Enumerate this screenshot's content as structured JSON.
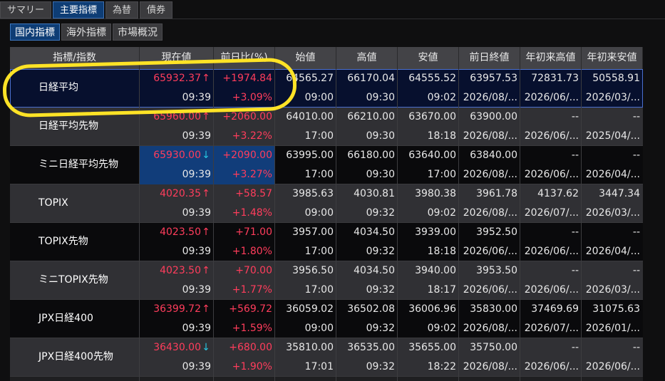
{
  "top_tabs": [
    "サマリー",
    "主要指標",
    "為替",
    "債券"
  ],
  "top_active": 1,
  "sub_tabs": [
    "国内指標",
    "海外指標",
    "市場概況"
  ],
  "sub_active": 0,
  "columns": [
    "指標/指数",
    "現在値",
    "前日比(%)",
    "始値",
    "高値",
    "安値",
    "前日終値",
    "年初来高値",
    "年初来安値"
  ],
  "colors": {
    "up": "#ff3d5c",
    "down": "#27c4e0",
    "annotation": "#ffe326",
    "selected_row": "#07102e"
  },
  "rows": [
    {
      "name": "日経平均",
      "price": "65932.37",
      "dir": "up",
      "chg": "+1974.84",
      "time": "09:39",
      "pct": "+3.09%",
      "open": "64565.27",
      "open_t": "09:00",
      "high": "66170.04",
      "high_t": "09:30",
      "low": "64555.52",
      "low_t": "09:02",
      "prev": "63957.53",
      "prev_d": "2026/08/...",
      "yh": "72831.73",
      "yh_d": "2026/06/...",
      "yl": "50558.91",
      "yl_d": "2026/03/...",
      "selected": true,
      "highlight": false
    },
    {
      "name": "日経平均先物",
      "price": "65960.00",
      "dir": "up",
      "chg": "+2060.00",
      "time": "09:39",
      "pct": "+3.22%",
      "open": "64010.00",
      "open_t": "17:00",
      "high": "66210.00",
      "high_t": "09:30",
      "low": "63670.00",
      "low_t": "18:18",
      "prev": "63900.00",
      "prev_d": "2026/08/...",
      "yh": "--",
      "yh_d": "2026/06/...",
      "yl": "--",
      "yl_d": "2025/04/...",
      "selected": false,
      "highlight": false
    },
    {
      "name": "ミニ日経平均先物",
      "price": "65930.00",
      "dir": "down",
      "chg": "+2090.00",
      "time": "09:39",
      "pct": "+3.27%",
      "open": "63995.00",
      "open_t": "17:00",
      "high": "66180.00",
      "high_t": "09:30",
      "low": "63640.00",
      "low_t": "17:00",
      "prev": "63840.00",
      "prev_d": "2026/08/...",
      "yh": "--",
      "yh_d": "2026/06/...",
      "yl": "--",
      "yl_d": "2026/04/...",
      "selected": false,
      "highlight": true
    },
    {
      "name": "TOPIX",
      "price": "4020.35",
      "dir": "up",
      "chg": "+58.57",
      "time": "09:39",
      "pct": "+1.48%",
      "open": "3985.63",
      "open_t": "09:00",
      "high": "4030.81",
      "high_t": "09:32",
      "low": "3980.38",
      "low_t": "09:02",
      "prev": "3961.78",
      "prev_d": "2026/08/...",
      "yh": "4137.62",
      "yh_d": "2026/07/...",
      "yl": "3447.34",
      "yl_d": "2026/03/...",
      "selected": false,
      "highlight": false
    },
    {
      "name": "TOPIX先物",
      "price": "4023.50",
      "dir": "up",
      "chg": "+71.00",
      "time": "09:39",
      "pct": "+1.80%",
      "open": "3957.00",
      "open_t": "17:00",
      "high": "4034.50",
      "high_t": "09:32",
      "low": "3939.00",
      "low_t": "18:18",
      "prev": "3952.50",
      "prev_d": "2026/06/...",
      "yh": "--",
      "yh_d": "2026/06/...",
      "yl": "--",
      "yl_d": "2026/04/...",
      "selected": false,
      "highlight": false
    },
    {
      "name": "ミニTOPIX先物",
      "price": "4023.50",
      "dir": "up",
      "chg": "+70.00",
      "time": "09:39",
      "pct": "+1.77%",
      "open": "3956.50",
      "open_t": "17:00",
      "high": "4034.50",
      "high_t": "09:32",
      "low": "3940.00",
      "low_t": "18:17",
      "prev": "3953.50",
      "prev_d": "2026/06/...",
      "yh": "--",
      "yh_d": "2026/06/...",
      "yl": "--",
      "yl_d": "2026/03/...",
      "selected": false,
      "highlight": false
    },
    {
      "name": "JPX日経400",
      "price": "36399.72",
      "dir": "up",
      "chg": "+569.72",
      "time": "09:39",
      "pct": "+1.59%",
      "open": "36059.02",
      "open_t": "09:00",
      "high": "36502.08",
      "high_t": "09:32",
      "low": "36006.96",
      "low_t": "09:02",
      "prev": "35830.00",
      "prev_d": "2026/08/...",
      "yh": "37469.69",
      "yh_d": "2026/07/...",
      "yl": "31075.63",
      "yl_d": "2026/01/...",
      "selected": false,
      "highlight": false
    },
    {
      "name": "JPX日経400先物",
      "price": "36430.00",
      "dir": "down",
      "chg": "+680.00",
      "time": "09:39",
      "pct": "+1.90%",
      "open": "35810.00",
      "open_t": "17:01",
      "high": "36535.00",
      "high_t": "09:32",
      "low": "35655.00",
      "low_t": "18:22",
      "prev": "35750.00",
      "prev_d": "2026/08/...",
      "yh": "--",
      "yh_d": "2026/06/...",
      "yl": "--",
      "yl_d": "2026/06/...",
      "selected": false,
      "highlight": false
    }
  ]
}
